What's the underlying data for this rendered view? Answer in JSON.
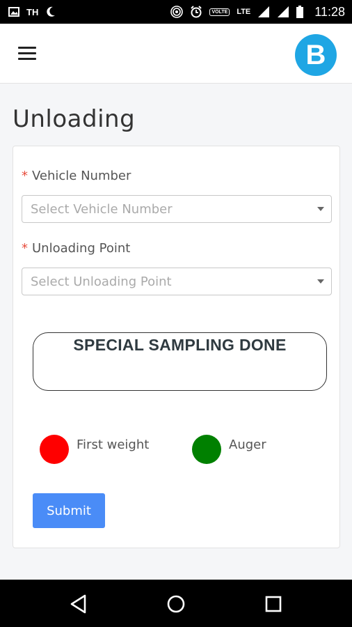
{
  "status_bar": {
    "carrier": "TH",
    "volte": "VOLTE",
    "network": "LTE",
    "time": "11:28",
    "icons": [
      "image-icon",
      "moon-icon",
      "hotspot-icon",
      "alarm-icon",
      "signal-icon",
      "battery-icon"
    ]
  },
  "header": {
    "logo_text": "B",
    "logo_color": "#1fa6e4"
  },
  "page": {
    "title": "Unloading"
  },
  "form": {
    "vehicle": {
      "required_mark": "*",
      "label": "Vehicle Number",
      "placeholder": "Select Vehicle Number"
    },
    "unloading_point": {
      "required_mark": "*",
      "label": "Unloading Point",
      "placeholder": "Select Unloading Point"
    },
    "banner_text": "SPECIAL SAMPLING DONE",
    "legend": [
      {
        "label": "First weight",
        "color": "#ff0000"
      },
      {
        "label": "Auger",
        "color": "#008000"
      }
    ],
    "submit_label": "Submit"
  },
  "nav_bar": {
    "buttons": [
      "back-icon",
      "home-icon",
      "recents-icon"
    ]
  }
}
